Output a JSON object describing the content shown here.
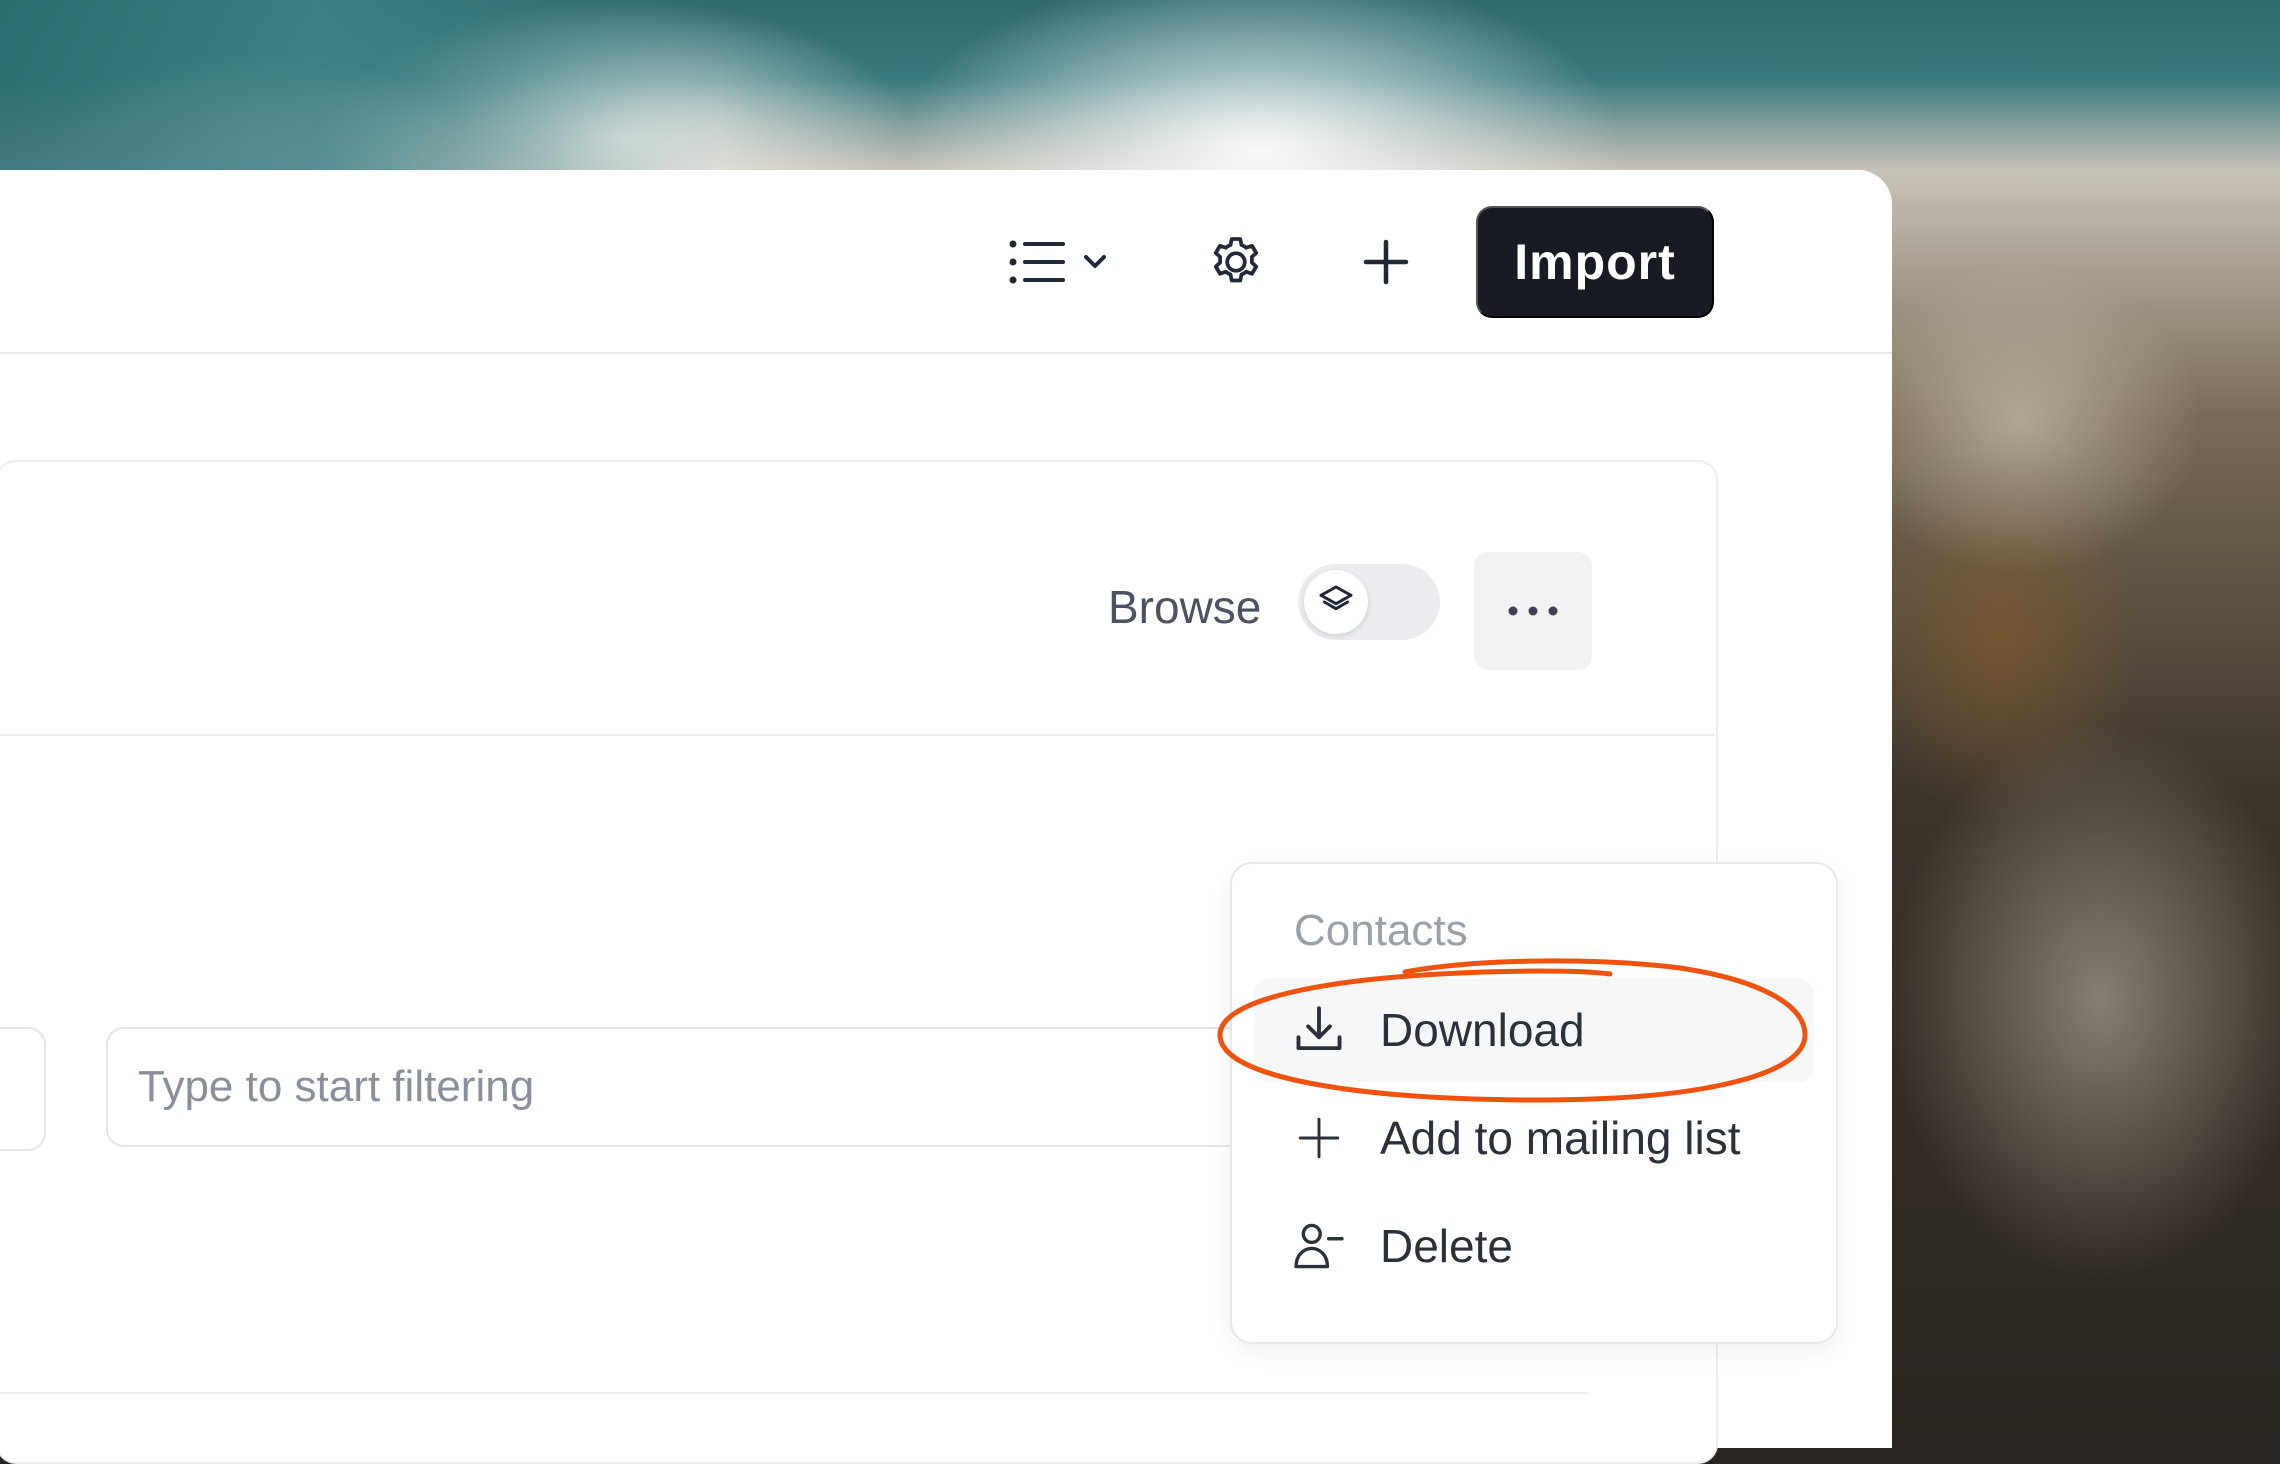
{
  "header": {
    "import_label": "Import",
    "icons": [
      "list-view-icon",
      "chevron-down-icon",
      "gear-icon",
      "plus-icon"
    ]
  },
  "toolbar": {
    "browse_label": "Browse",
    "toggle_icon": "layers-icon",
    "more_icon": "ellipsis-icon"
  },
  "filter": {
    "placeholder": "Type to start filtering"
  },
  "menu": {
    "heading": "Contacts",
    "items": [
      {
        "label": "Download",
        "icon": "download-icon",
        "active": true
      },
      {
        "label": "Add to mailing list",
        "icon": "plus-icon",
        "active": false
      },
      {
        "label": "Delete",
        "icon": "user-minus-icon",
        "active": false
      }
    ]
  },
  "colors": {
    "primary_button": "#171b22",
    "annotation": "#f0520f"
  }
}
